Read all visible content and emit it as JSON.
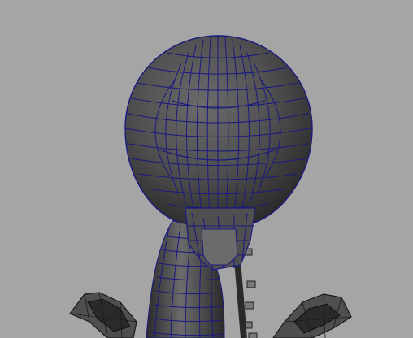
{
  "viewport": {
    "background": "#a5a5a5",
    "shading": "smooth-shaded-with-wireframe-on-shaded"
  },
  "colors": {
    "wireframe": "#1a1a80",
    "surface_light": "#6b6b6b",
    "surface_mid": "#4f4f4f",
    "surface_dark": "#2a2a2a",
    "bolt": "#777777"
  },
  "scene": {
    "objects": [
      {
        "name": "head-mesh",
        "kind": "sphere-head"
      },
      {
        "name": "neck-mesh",
        "kind": "curved-neck"
      },
      {
        "name": "jaw-mesh",
        "kind": "jaw-block"
      },
      {
        "name": "spine-bolts",
        "kind": "hardware"
      },
      {
        "name": "left-claw-mesh",
        "kind": "claw"
      },
      {
        "name": "right-claw-mesh",
        "kind": "claw"
      }
    ]
  }
}
